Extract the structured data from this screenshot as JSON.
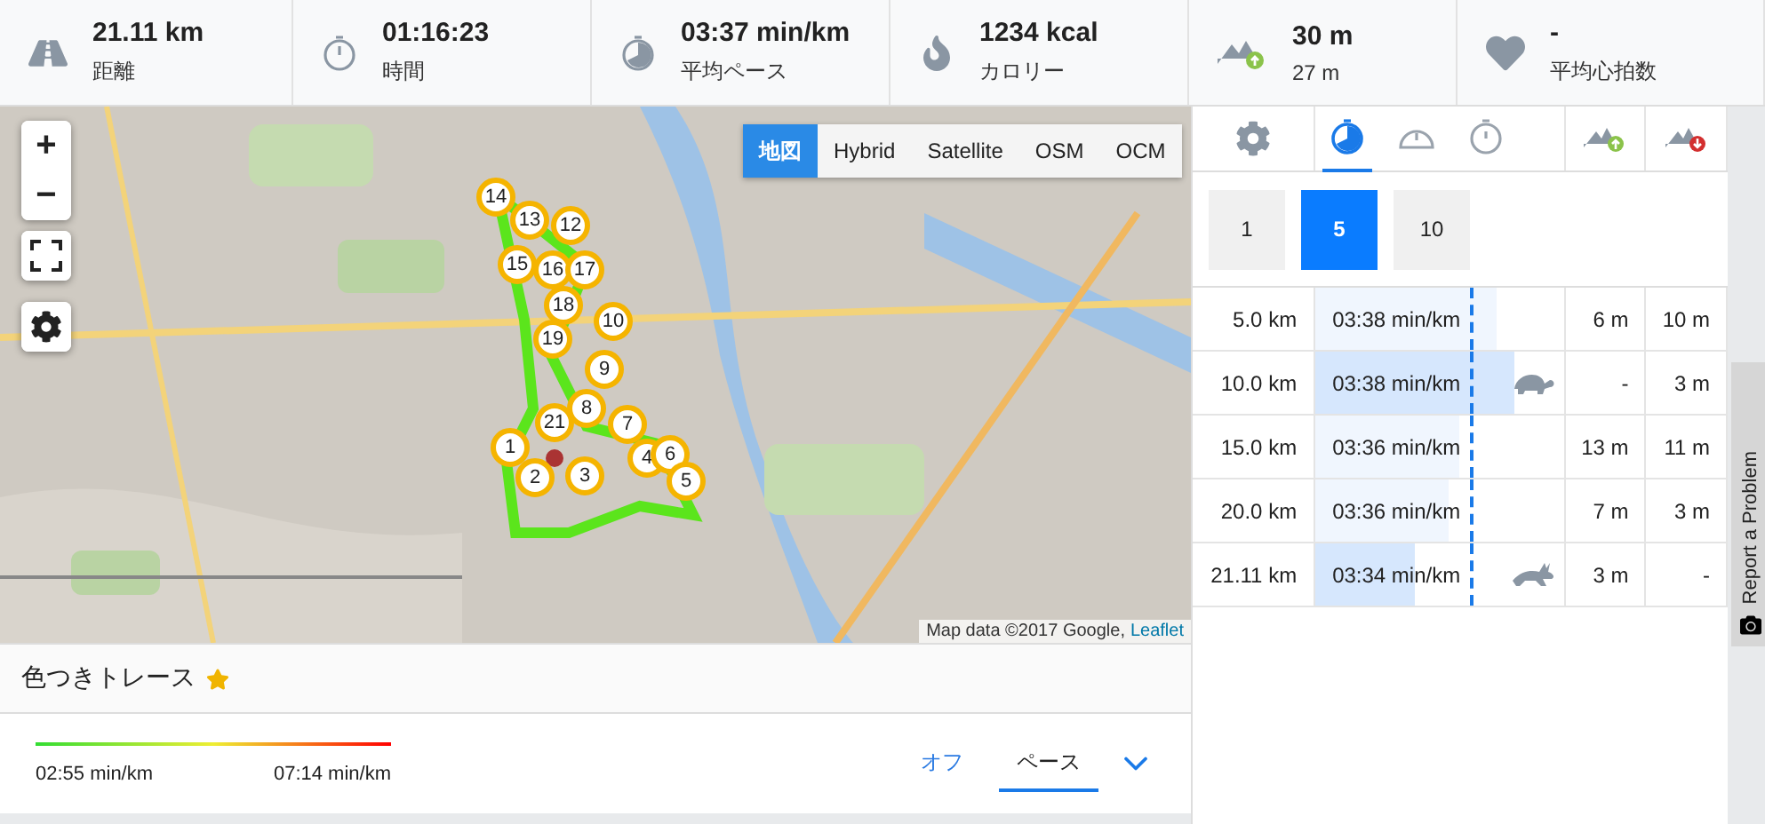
{
  "stats": [
    {
      "kind": "distance",
      "value": "21.11 km",
      "label": "距離"
    },
    {
      "kind": "time",
      "value": "01:16:23",
      "label": "時間"
    },
    {
      "kind": "pace",
      "value": "03:37 min/km",
      "label": "平均ペース"
    },
    {
      "kind": "calories",
      "value": "1234 kcal",
      "label": "カロリー"
    },
    {
      "kind": "elevation",
      "value": "30 m",
      "label": "27 m"
    },
    {
      "kind": "heart",
      "value": "-",
      "label": "平均心拍数"
    }
  ],
  "map": {
    "zoom_in": "+",
    "zoom_out": "−",
    "layers": [
      {
        "label": "地図",
        "selected": true
      },
      {
        "label": "Hybrid",
        "selected": false
      },
      {
        "label": "Satellite",
        "selected": false
      },
      {
        "label": "OSM",
        "selected": false
      },
      {
        "label": "OCM",
        "selected": false
      }
    ],
    "markers": [
      "14",
      "13",
      "12",
      "15",
      "16",
      "17",
      "18",
      "19",
      "10",
      "9",
      "8",
      "21",
      "7",
      "1",
      "4",
      "6",
      "2",
      "3",
      "5"
    ],
    "attribution": "Map data ©2017 Google,",
    "attribution_link": "Leaflet"
  },
  "trace": {
    "title": "色つきトレース",
    "legend_min": "02:55 min/km",
    "legend_max": "07:14 min/km",
    "modes": [
      {
        "label": "オフ",
        "selected": false
      },
      {
        "label": "ペース",
        "selected": true
      }
    ]
  },
  "tabs": [
    {
      "kind": "pace",
      "selected": true
    },
    {
      "kind": "speed",
      "selected": false
    },
    {
      "kind": "time",
      "selected": false
    }
  ],
  "intervals": [
    {
      "label": "1",
      "selected": false
    },
    {
      "label": "5",
      "selected": true
    },
    {
      "label": "10",
      "selected": false
    }
  ],
  "splits": [
    {
      "distance": "5.0 km",
      "pace": "03:38 min/km",
      "level": 0.73,
      "highlight": false,
      "up": "6 m",
      "down": "10 m"
    },
    {
      "distance": "10.0 km",
      "pace": "03:38 min/km",
      "level": 0.8,
      "highlight": true,
      "kind": "slowest",
      "up": "-",
      "down": "3 m"
    },
    {
      "distance": "15.0 km",
      "pace": "03:36 min/km",
      "level": 0.58,
      "highlight": false,
      "up": "13 m",
      "down": "11 m"
    },
    {
      "distance": "20.0 km",
      "pace": "03:36 min/km",
      "level": 0.54,
      "highlight": false,
      "up": "7 m",
      "down": "3 m"
    },
    {
      "distance": "21.11 km",
      "pace": "03:34 min/km",
      "level": 0.4,
      "highlight": true,
      "kind": "fastest",
      "up": "3 m",
      "down": "-"
    }
  ],
  "report_tab": "Report a Problem"
}
